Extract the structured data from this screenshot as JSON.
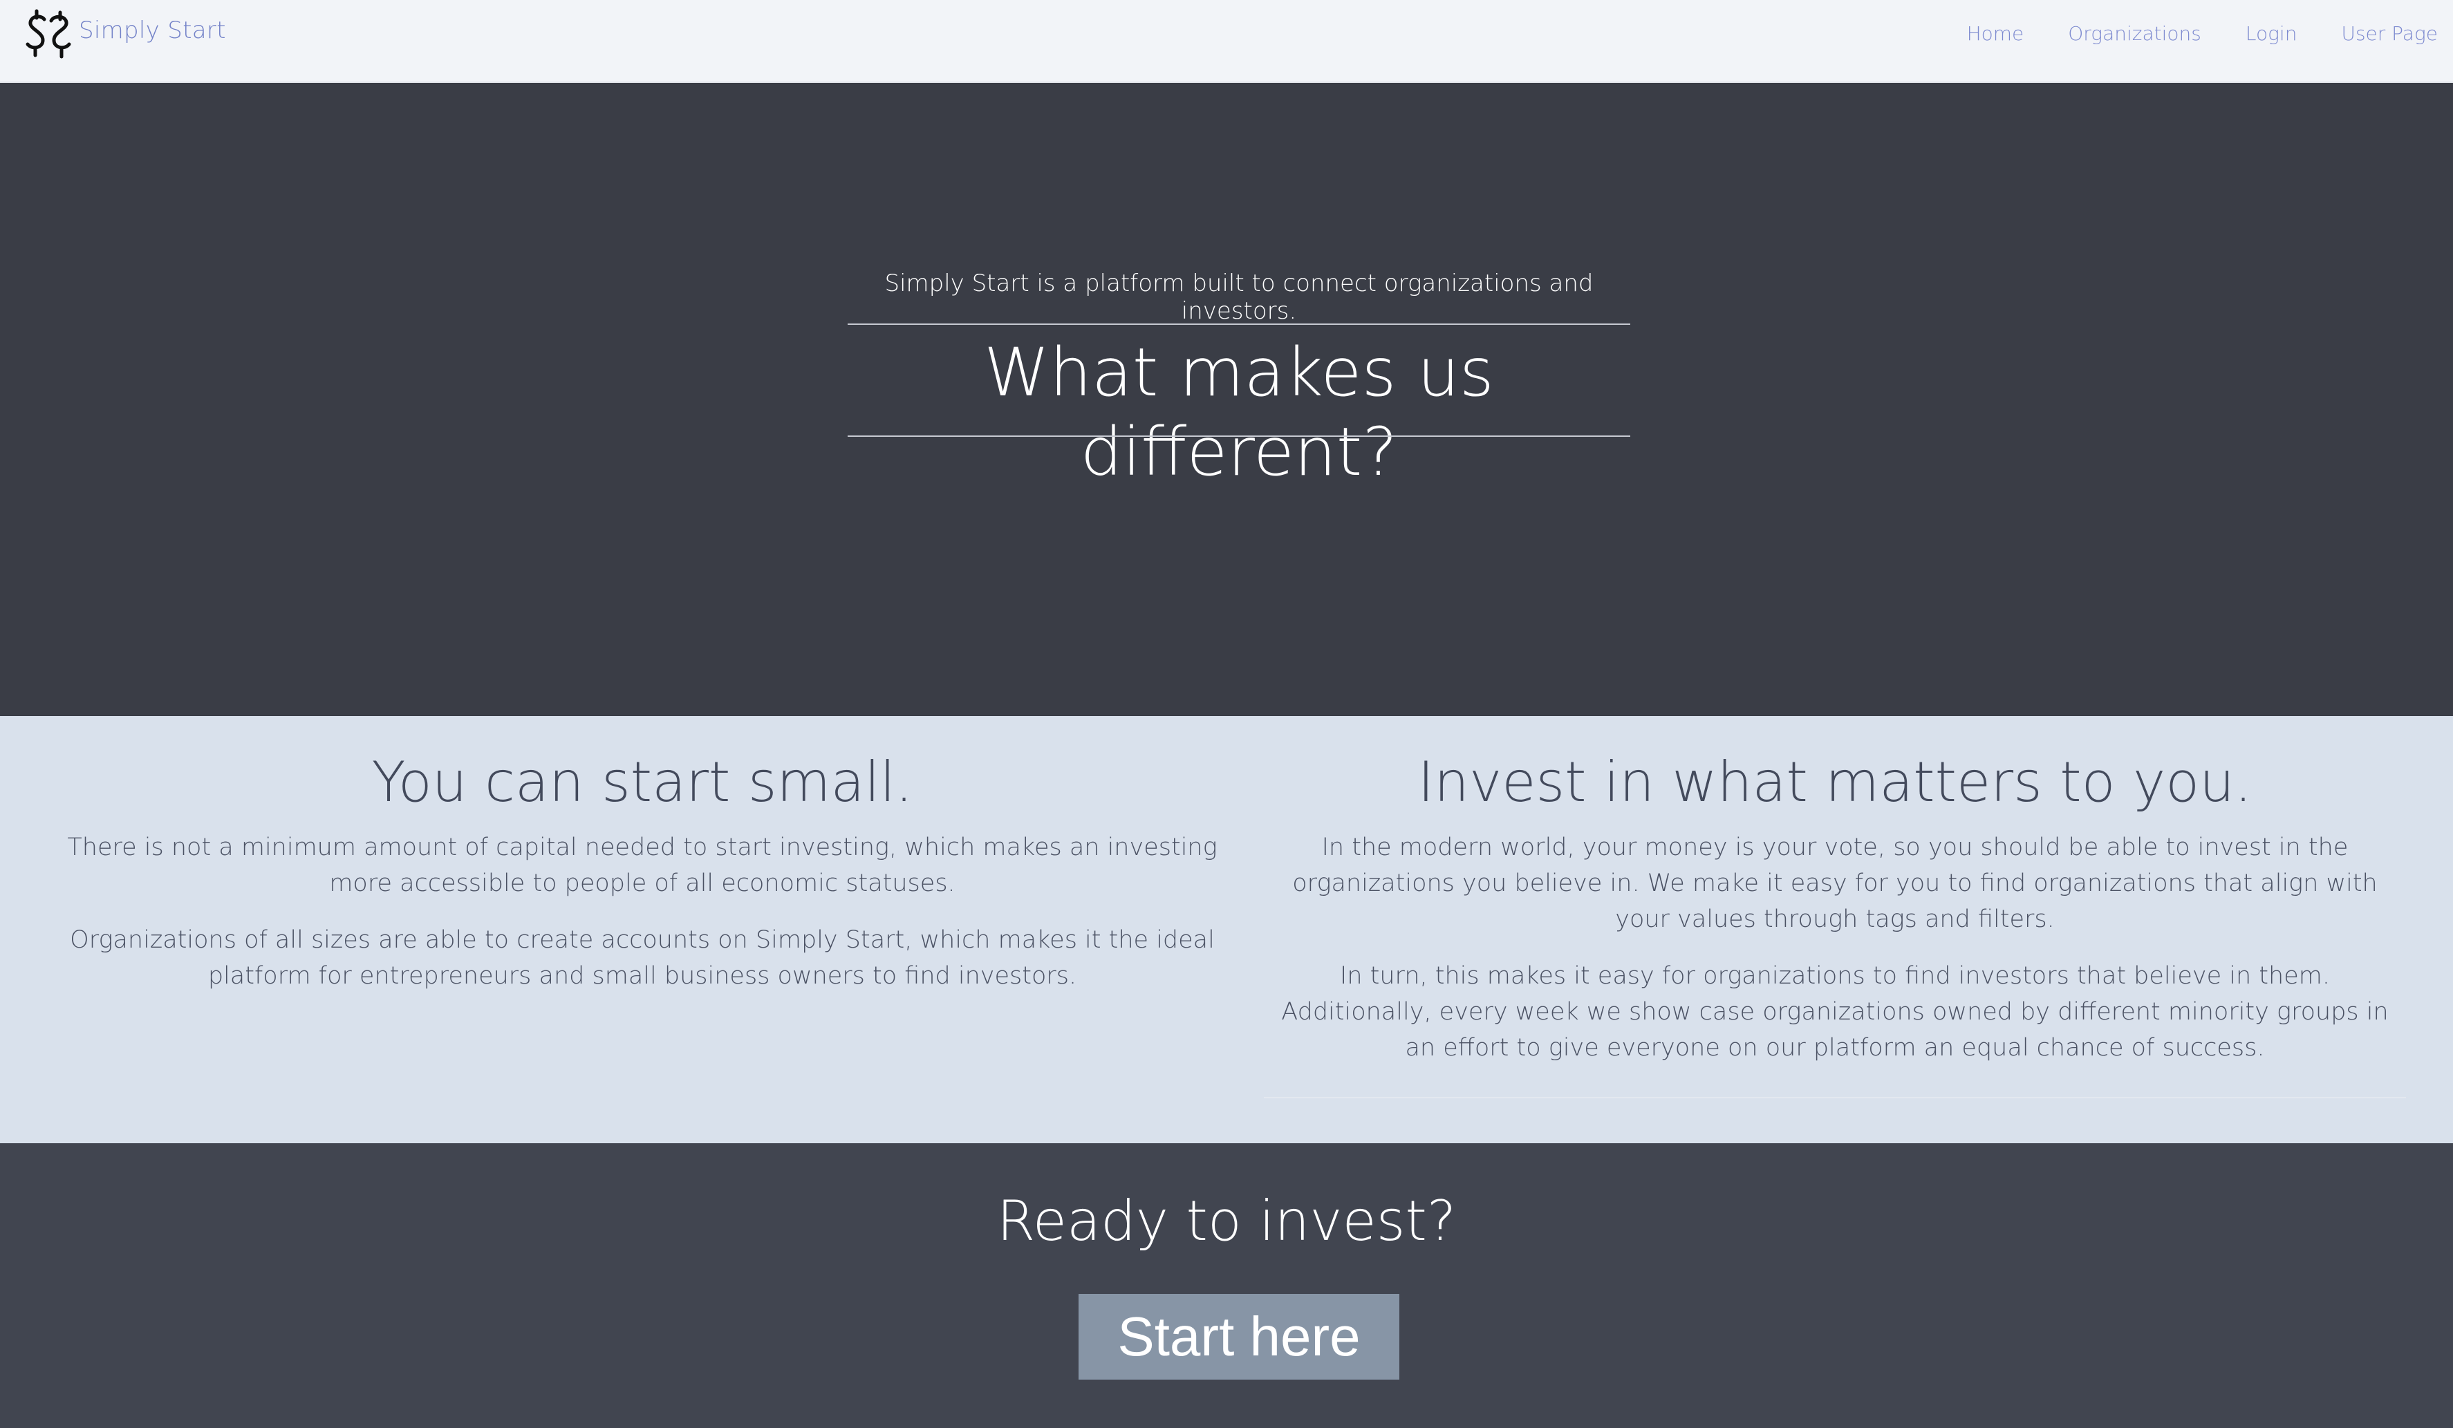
{
  "navbar": {
    "brand": "Simply Start",
    "logo_icon": "dollar-signs-logo-icon",
    "links": [
      "Home",
      "Organizations",
      "Login",
      "User Page"
    ],
    "link_color": "#7e8bd0"
  },
  "hero": {
    "subtitle": "Simply Start is a platform built to connect organizations and investors.",
    "title": "What makes us different?",
    "background": "#3a3d46"
  },
  "features": {
    "background": "#d9e1ec",
    "left": {
      "title": "You can start small.",
      "paragraphs": [
        "There is not a minimum amount of capital needed to start investing, which makes an investing more accessible to people of all economic statuses.",
        "Organizations of all sizes are able to create accounts on Simply Start, which makes it the ideal platform for entrepreneurs and small business owners to find investors."
      ]
    },
    "right": {
      "title": "Invest in what matters to you.",
      "paragraphs": [
        "In the modern world, your money is your vote, so you should be able to invest in the organizations you believe in. We make it easy for you to find organizations that align with your values through tags and filters.",
        "In turn, this makes it easy for organizations to find investors that believe in them. Additionally, every week we show case organizations owned by different minority groups in an effort to give everyone on our platform an equal chance of success."
      ]
    }
  },
  "cta": {
    "title": "Ready to invest?",
    "button_label": "Start here",
    "button_color": "#8795a6",
    "background": "#414550"
  }
}
